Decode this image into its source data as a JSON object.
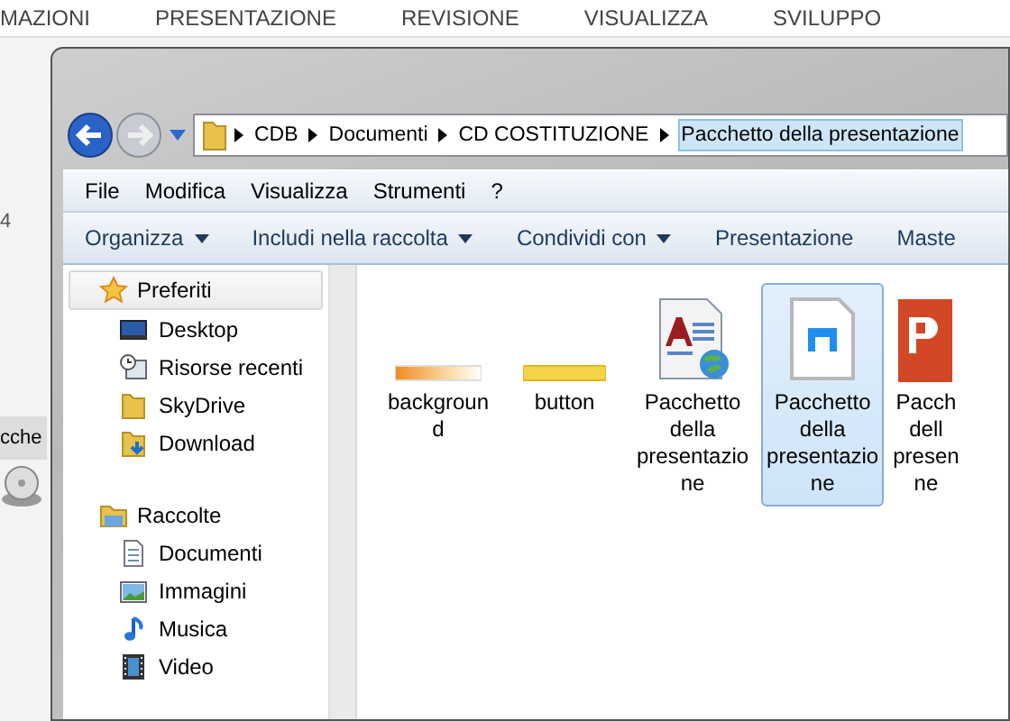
{
  "background_app": {
    "ribbon_tabs": [
      "MAZIONI",
      "PRESENTAZIONE",
      "REVISIONE",
      "VISUALIZZA",
      "SVILUPPO"
    ],
    "ruler_mark": "4",
    "tab_fragment": "cche"
  },
  "window": {
    "breadcrumb": [
      {
        "label": "CDB",
        "selected": false
      },
      {
        "label": "Documenti",
        "selected": false
      },
      {
        "label": "CD COSTITUZIONE",
        "selected": false
      },
      {
        "label": "Pacchetto della presentazione",
        "selected": true
      }
    ],
    "menu": [
      "File",
      "Modifica",
      "Visualizza",
      "Strumenti",
      "?"
    ],
    "toolbar": [
      {
        "label": "Organizza",
        "dropdown": true
      },
      {
        "label": "Includi nella raccolta",
        "dropdown": true
      },
      {
        "label": "Condividi con",
        "dropdown": true
      },
      {
        "label": "Presentazione",
        "dropdown": false
      },
      {
        "label": "Maste",
        "dropdown": false
      }
    ],
    "sidebar": [
      {
        "label": "Preferiti",
        "kind": "star",
        "children": [
          {
            "label": "Desktop",
            "kind": "desktop"
          },
          {
            "label": "Risorse recenti",
            "kind": "recent"
          },
          {
            "label": "SkyDrive",
            "kind": "folder"
          },
          {
            "label": "Download",
            "kind": "download"
          }
        ]
      },
      {
        "label": "Raccolte",
        "kind": "library",
        "children": [
          {
            "label": "Documenti",
            "kind": "document"
          },
          {
            "label": "Immagini",
            "kind": "image"
          },
          {
            "label": "Musica",
            "kind": "music"
          },
          {
            "label": "Video",
            "kind": "video"
          }
        ]
      }
    ],
    "files": [
      {
        "lines": [
          "backgroun",
          "d"
        ],
        "kind": "orange-strip",
        "selected": false
      },
      {
        "lines": [
          "button"
        ],
        "kind": "yellow-strip",
        "selected": false
      },
      {
        "lines": [
          "Pacchetto",
          "della",
          "presentazio",
          "ne"
        ],
        "kind": "html",
        "selected": false
      },
      {
        "lines": [
          "Pacchetto",
          "della",
          "presentazio",
          "ne"
        ],
        "kind": "blank-file",
        "selected": true
      },
      {
        "lines": [
          "Pacch",
          "dell",
          "presen",
          "ne"
        ],
        "kind": "pptx",
        "selected": false
      }
    ]
  }
}
